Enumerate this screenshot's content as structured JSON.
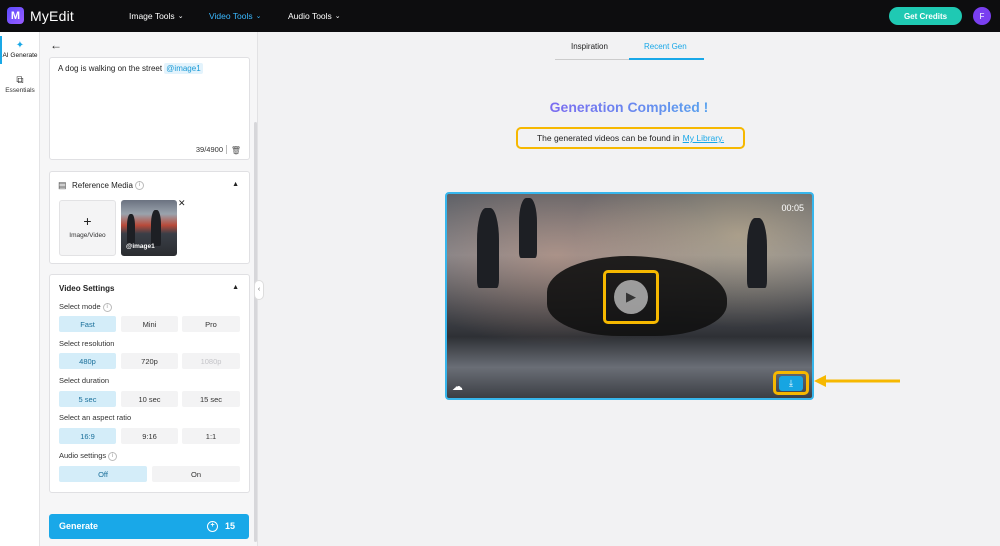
{
  "topbar": {
    "brand": "MyEdit",
    "logo_letter": "M",
    "nav": [
      {
        "label": "Image Tools",
        "active": false
      },
      {
        "label": "Video Tools",
        "active": true
      },
      {
        "label": "Audio Tools",
        "active": false
      }
    ],
    "credits_label": "Get Credits",
    "avatar_letter": "F",
    "accent": "#3ab8ff"
  },
  "rail": {
    "items": [
      {
        "label": "AI Generate",
        "icon": "magic-wand-icon"
      },
      {
        "label": "Essentials",
        "icon": "squares-icon"
      }
    ]
  },
  "panel": {
    "prompt": {
      "text": "A dog is walking on the street ",
      "tag": "@image1",
      "counter": "39/4900"
    },
    "reference": {
      "title": "Reference Media",
      "upload_label": "Image/Video",
      "thumb_tag": "@image1"
    },
    "video_settings": {
      "title": "Video Settings",
      "mode_label": "Select mode",
      "modes": [
        "Fast",
        "Mini",
        "Pro"
      ],
      "resolution_label": "Select resolution",
      "resolutions": [
        "480p",
        "720p",
        "1080p"
      ],
      "duration_label": "Select duration",
      "durations": [
        "5 sec",
        "10 sec",
        "15 sec"
      ],
      "ratio_label": "Select an aspect ratio",
      "ratios": [
        "16:9",
        "9:16",
        "1:1"
      ],
      "audio_label": "Audio settings",
      "audio": [
        "Off",
        "On"
      ]
    },
    "generate": {
      "label": "Generate",
      "cost": "15"
    }
  },
  "main": {
    "tabs": [
      "Inspiration",
      "Recent Gen"
    ],
    "active_tab": "Recent Gen",
    "headline": "Generation Completed !",
    "notice_text": "The generated videos can be found in",
    "notice_link": "My Library.",
    "video": {
      "duration": "00:05"
    },
    "highlight_color": "#f6b800"
  }
}
